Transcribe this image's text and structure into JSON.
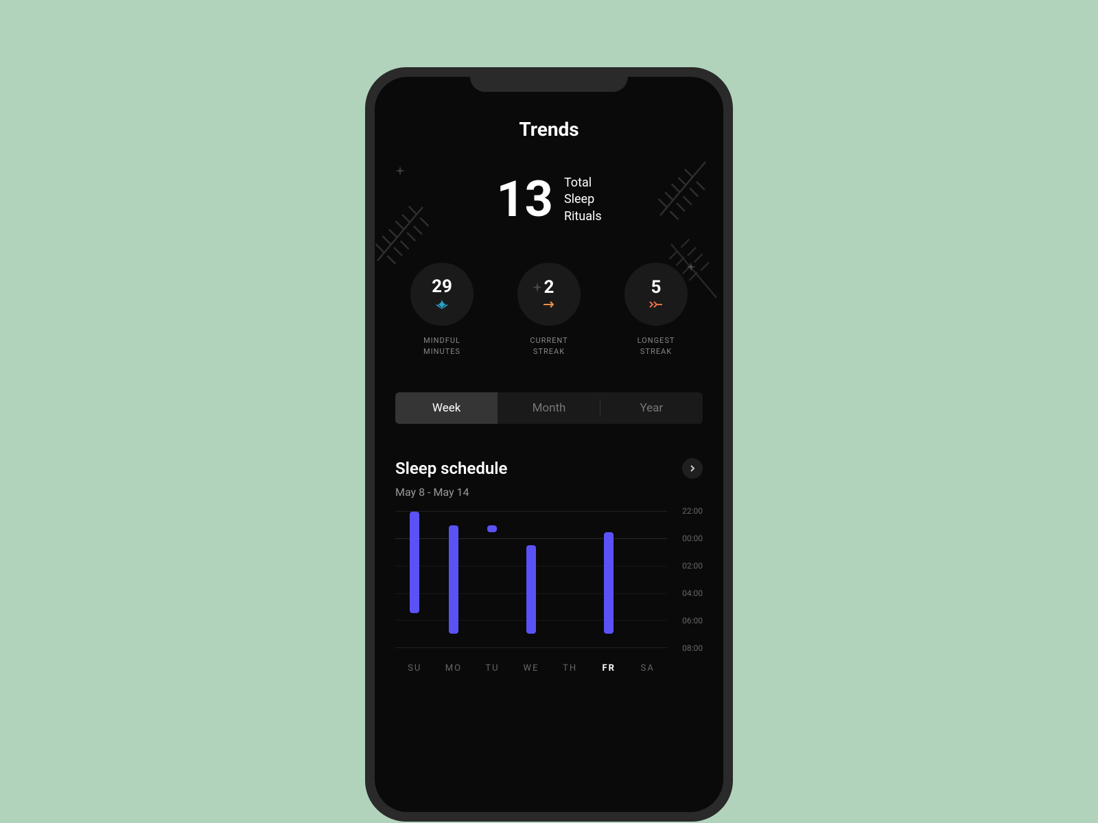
{
  "header": {
    "title": "Trends"
  },
  "hero": {
    "value": "13",
    "label_line1": "Total",
    "label_line2": "Sleep",
    "label_line3": "Rituals"
  },
  "stats": [
    {
      "value": "29",
      "label_line1": "MINDFUL",
      "label_line2": "MINUTES",
      "icon": "lotus",
      "icon_color": "#2aa1c9"
    },
    {
      "value": "2",
      "label_line1": "CURRENT",
      "label_line2": "STREAK",
      "icon": "arrow-right",
      "icon_color": "#e8914a"
    },
    {
      "value": "5",
      "label_line1": "LONGEST",
      "label_line2": "STREAK",
      "icon": "double-arrow-right",
      "icon_color": "#e8704a"
    }
  ],
  "tabs": [
    {
      "label": "Week",
      "active": true
    },
    {
      "label": "Month",
      "active": false
    },
    {
      "label": "Year",
      "active": false
    }
  ],
  "sleep_section": {
    "title": "Sleep schedule",
    "date_range": "May 8 - May 14"
  },
  "chart_data": {
    "type": "bar",
    "title": "Sleep schedule",
    "xlabel": "",
    "ylabel": "",
    "categories": [
      "SU",
      "MO",
      "TU",
      "WE",
      "TH",
      "FR",
      "SA"
    ],
    "active_category": "FR",
    "y_ticks": [
      "22:00",
      "00:00",
      "02:00",
      "04:00",
      "06:00",
      "08:00"
    ],
    "ylim": [
      "22:00",
      "08:00"
    ],
    "series": [
      {
        "name": "sleep-interval",
        "values": [
          {
            "day": "SU",
            "start": "22:00",
            "end": "05:30"
          },
          {
            "day": "MO",
            "start": "23:00",
            "end": "07:00"
          },
          {
            "day": "TU",
            "start": "23:00",
            "end": "23:30"
          },
          {
            "day": "WE",
            "start": "00:30",
            "end": "07:00"
          },
          {
            "day": "TH",
            "start": null,
            "end": null
          },
          {
            "day": "FR",
            "start": "23:30",
            "end": "07:00"
          },
          {
            "day": "SA",
            "start": null,
            "end": null
          }
        ]
      }
    ]
  }
}
